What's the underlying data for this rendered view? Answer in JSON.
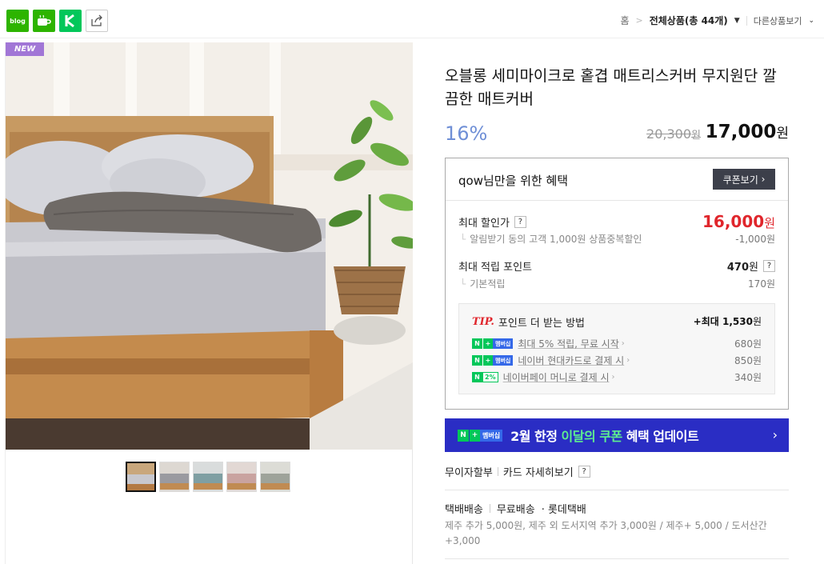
{
  "share": {
    "blog_icon_text": "blog",
    "icons": [
      "blog-icon",
      "cafe-icon",
      "kakaostory-icon",
      "share-icon"
    ]
  },
  "breadcrumb": {
    "home": "홈",
    "category": "전체상품(총 44개)",
    "other": "다른상품보기"
  },
  "product": {
    "badge": "NEW",
    "title": "오블롱 세미마이크로 홑겹 매트리스커버 무지원단 깔끔한 매트커버",
    "discount": "16%",
    "original_price": "20,300",
    "original_unit": "원",
    "sale_price": "17,000",
    "sale_unit": "원",
    "thumbnails": 5
  },
  "benefit": {
    "title": "qow님만을 위한 혜택",
    "coupon_button": "쿠폰보기",
    "max_discount_label": "최대 할인가",
    "max_discount_value": "16,000",
    "max_discount_unit": "원",
    "alert_note": "알림받기 동의 고객 1,000원 상품중복할인",
    "alert_value": "-1,000원",
    "max_points_label": "최대 적립 포인트",
    "max_points_value": "470",
    "max_points_unit": "원",
    "basic_points_label": "기본적립",
    "basic_points_value": "170원",
    "help": "?"
  },
  "tip": {
    "tip_label": "TIP.",
    "heading": "포인트 더 받는 방법",
    "max_label": "+최대 1,530",
    "max_unit": "원",
    "items": [
      {
        "badge_type": "membership",
        "label": "최대 5% 적립, 무료 시작",
        "value": "680원"
      },
      {
        "badge_type": "membership",
        "label": "네이버 현대카드로 결제 시",
        "value": "850원"
      },
      {
        "badge_type": "pay2",
        "label": "네이버페이 머니로 결제 시",
        "value": "340원"
      }
    ],
    "badge_n": "N",
    "badge_plus": "+",
    "badge_membership": "멤버십",
    "badge_pct": "2%"
  },
  "banner": {
    "text_a": "2월 한정 ",
    "text_hl": "이달의 쿠폰",
    "text_b": " 혜택 업데이트"
  },
  "payment": {
    "installment": "무이자할부",
    "card_detail": "카드 자세히보기"
  },
  "shipping": {
    "label": "택배배송",
    "free": "무료배송",
    "carrier": "· 롯데택배",
    "note": "제주 추가 5,000원, 제주 외 도서지역 추가 3,000원 / 제주+ 5,000 / 도서산간 +3,000"
  },
  "colors": {
    "accent_red": "#e0262c",
    "discount_blue": "#6f8fd6",
    "banner_bg": "#2a2dc4",
    "naver_green": "#03c75a",
    "new_badge": "#a176d6"
  }
}
